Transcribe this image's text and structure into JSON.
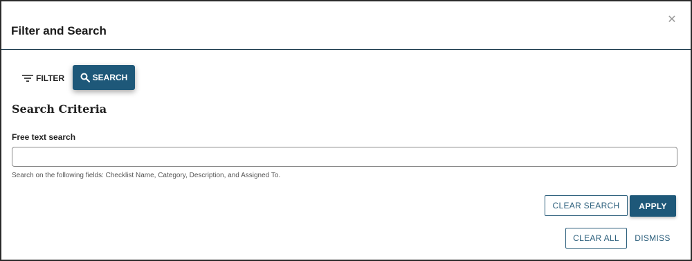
{
  "dialog": {
    "title": "Filter and Search",
    "close_icon": "close-icon"
  },
  "tabs": [
    {
      "label": "FILTER",
      "icon": "filter-lines-icon",
      "active": false
    },
    {
      "label": "SEARCH",
      "icon": "search-icon",
      "active": true
    }
  ],
  "search_criteria": {
    "heading": "Search Criteria",
    "field_label": "Free text search",
    "value": "",
    "placeholder": "",
    "hint": "Search on the following fields: Checklist Name, Category, Description, and Assigned To."
  },
  "actions": {
    "clear_search": "CLEAR SEARCH",
    "apply": "APPLY",
    "clear_all": "CLEAR ALL",
    "dismiss": "DISMISS"
  },
  "colors": {
    "primary": "#1e5879",
    "outline": "#2c5f7c",
    "header_rule": "#1d3b4e"
  }
}
